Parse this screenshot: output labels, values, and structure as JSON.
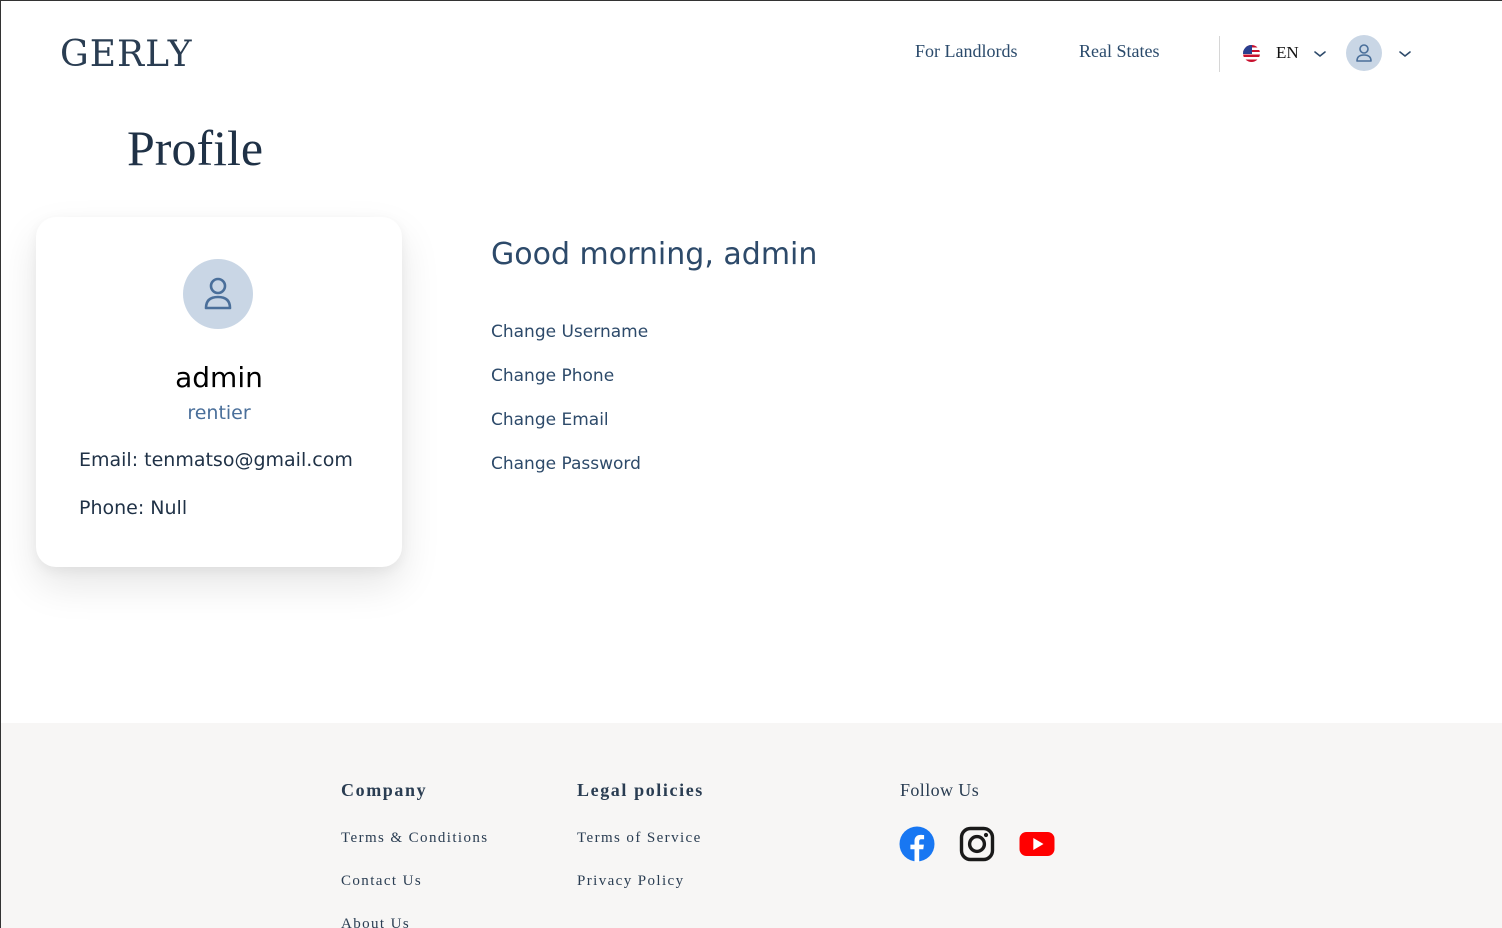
{
  "header": {
    "logo": "GERLY",
    "nav": [
      "For Landlords",
      "Real States"
    ],
    "language": "EN"
  },
  "page": {
    "title": "Profile"
  },
  "profile": {
    "username": "admin",
    "role": "rentier",
    "email_line": "Email: tenmatso@gmail.com",
    "phone_line": "Phone: Null"
  },
  "main": {
    "greeting": "Good morning, admin",
    "actions": [
      "Change Username",
      "Change Phone",
      "Change Email",
      "Change Password"
    ]
  },
  "footer": {
    "company": {
      "heading": "Company",
      "links": [
        "Terms & Conditions",
        "Contact Us",
        "About Us"
      ]
    },
    "legal": {
      "heading": "Legal policies",
      "links": [
        "Terms of Service",
        "Privacy Policy"
      ]
    },
    "follow": {
      "heading": "Follow Us",
      "icons": [
        "facebook-icon",
        "instagram-icon",
        "youtube-icon"
      ]
    }
  },
  "colors": {
    "primary_text": "#2d4a6a",
    "avatar_bg": "#c9d6e5",
    "footer_bg": "#f7f6f5",
    "facebook": "#1877f2",
    "youtube": "#ff0000"
  }
}
